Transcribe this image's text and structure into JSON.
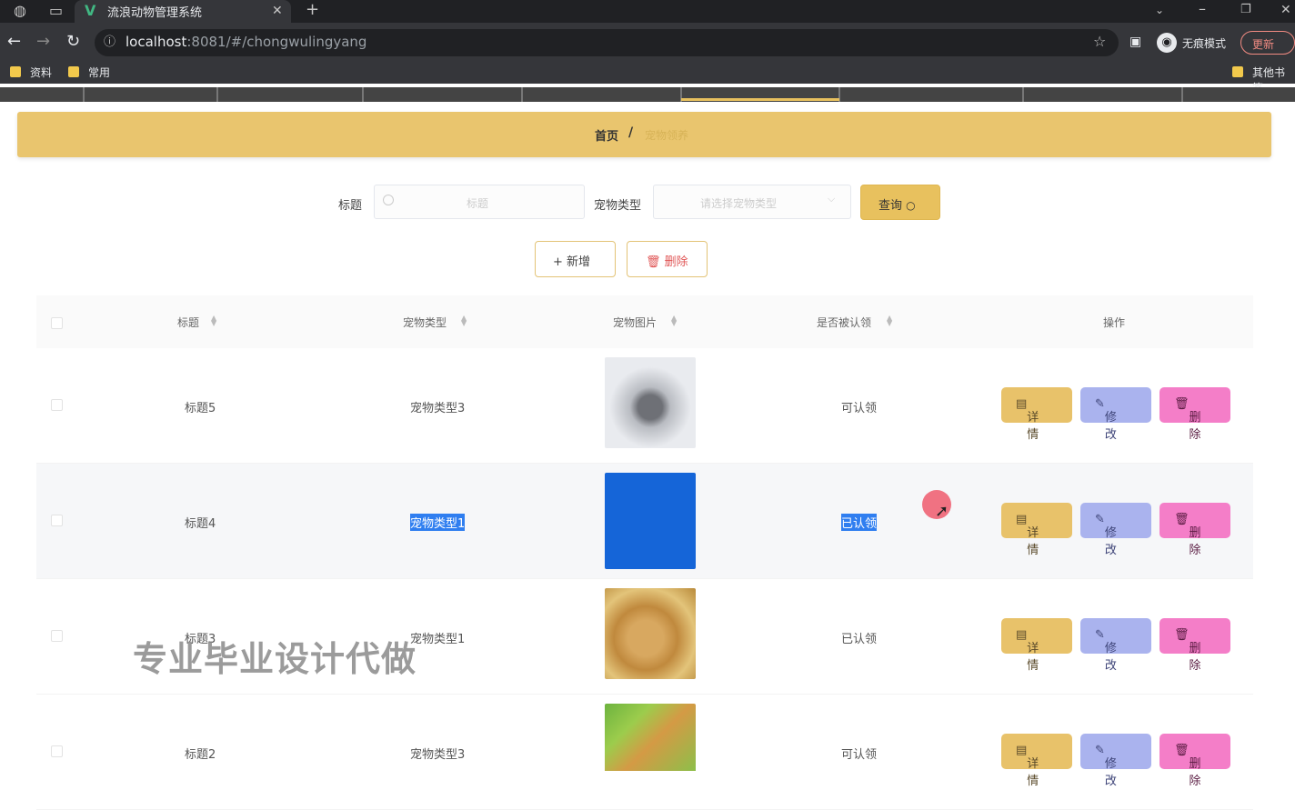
{
  "browser": {
    "tab_title": "流浪动物管理系统",
    "url_host": "localhost",
    "url_rest": ":8081/#/chongwulingyang",
    "incognito_label": "无痕模式",
    "update_label": "更新",
    "bookmarks": [
      "资料",
      "常用"
    ],
    "other_bookmarks": "其他书签"
  },
  "breadcrumb": {
    "home": "首页",
    "separator": "/",
    "current": "宠物领养"
  },
  "search": {
    "title_label": "标题",
    "title_placeholder": "标题",
    "type_label": "宠物类型",
    "type_placeholder": "请选择宠物类型",
    "query_label": "查询"
  },
  "actions": {
    "add_label": "新增",
    "delete_label": "删除"
  },
  "table": {
    "columns": [
      "标题",
      "宠物类型",
      "宠物图片",
      "是否被认领",
      "操作"
    ],
    "rows": [
      {
        "title": "标题5",
        "type": "宠物类型3",
        "status": "可认领"
      },
      {
        "title": "标题4",
        "type": "宠物类型1",
        "status": "已认领"
      },
      {
        "title": "标题3",
        "type": "宠物类型1",
        "status": "已认领"
      },
      {
        "title": "标题2",
        "type": "宠物类型3",
        "status": "可认领"
      }
    ],
    "row_actions": {
      "detail": "详情",
      "edit": "修改",
      "delete": "删除"
    }
  },
  "watermark": "专业毕业设计代做",
  "colors": {
    "accent": "#e8c15e",
    "edit": "#aab3ee",
    "delete": "#f47ec8",
    "selection": "#2f7ef0"
  }
}
